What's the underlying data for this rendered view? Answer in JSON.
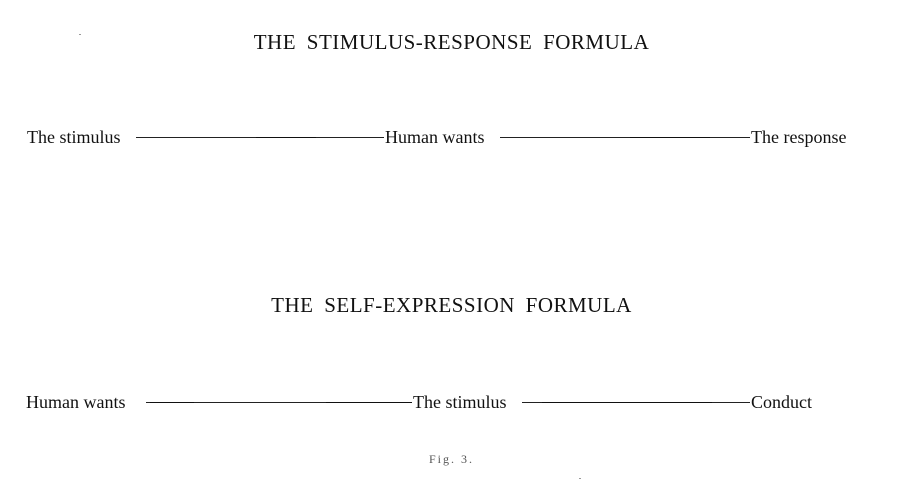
{
  "diagram": {
    "stimulus_response": {
      "title": "THE STIMULUS-RESPONSE FORMULA",
      "nodes": [
        "The stimulus",
        "Human wants",
        "The response"
      ]
    },
    "self_expression": {
      "title": "THE SELF-EXPRESSION FORMULA",
      "nodes": [
        "Human wants",
        "The stimulus",
        "Conduct"
      ]
    },
    "caption": "Fig. 3."
  }
}
